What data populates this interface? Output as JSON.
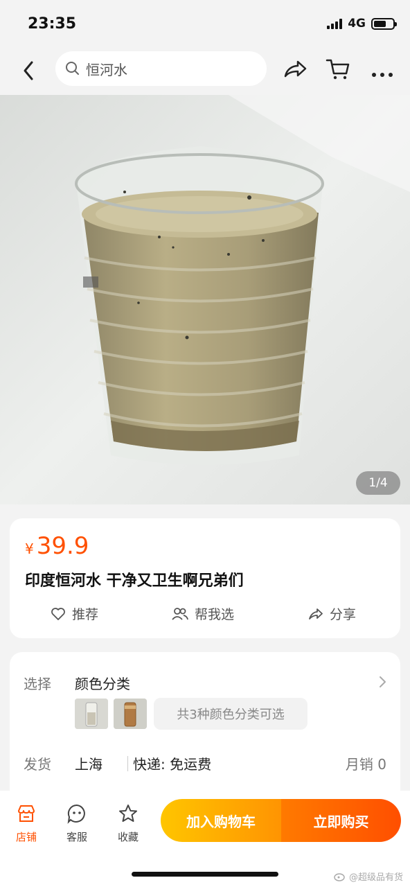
{
  "status": {
    "time": "23:35",
    "network": "4G"
  },
  "nav": {
    "search_text": "恒河水"
  },
  "gallery": {
    "page_indicator": "1/4"
  },
  "product": {
    "currency": "¥",
    "price": "39.9",
    "title": "印度恒河水 干净又卫生啊兄弟们"
  },
  "actions": {
    "recommend": "推荐",
    "help_choose": "帮我选",
    "share": "分享"
  },
  "spec": {
    "select_label": "选择",
    "select_value": "颜色分类",
    "variants_text": "共3种颜色分类可选",
    "ship_label": "发货",
    "ship_from": "上海",
    "delivery": "快递: 免运费",
    "sales": "月销  0"
  },
  "bottom": {
    "store": "店铺",
    "service": "客服",
    "favorite": "收藏",
    "add_cart": "加入购物车",
    "buy_now": "立即购买"
  },
  "watermark": "@超级品有货",
  "colors": {
    "accent": "#ff5000",
    "cart_gradient_start": "#ffc500",
    "buy_gradient_end": "#ff4f00"
  }
}
